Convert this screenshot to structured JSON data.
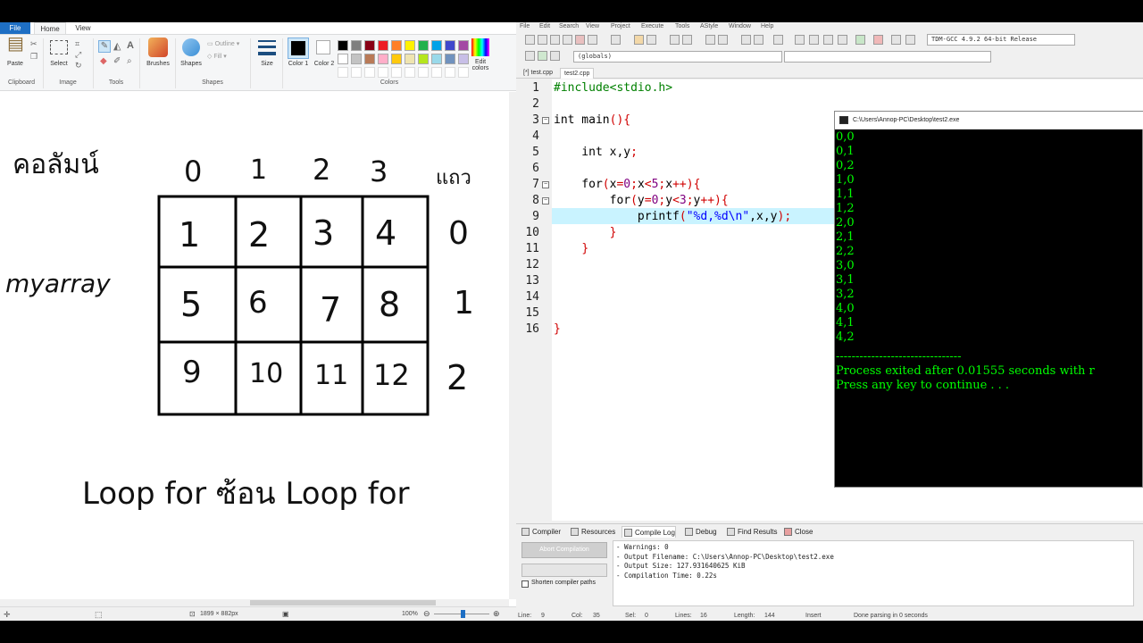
{
  "paint": {
    "tabs": {
      "file": "File",
      "home": "Home",
      "view": "View"
    },
    "ribbon": {
      "paste": "Paste",
      "select": "Select",
      "brushes": "Brushes",
      "shapes": "Shapes",
      "outline": "Outline",
      "fill": "Fill",
      "size": "Size",
      "color1": "Color 1",
      "color2": "Color 2",
      "edit_colors": "Edit colors",
      "groups": {
        "clipboard": "Clipboard",
        "image": "Image",
        "tools": "Tools",
        "shapes": "Shapes",
        "colors": "Colors"
      },
      "palette": [
        "#000000",
        "#7f7f7f",
        "#880015",
        "#ed1c24",
        "#ff7f27",
        "#fff200",
        "#22b14c",
        "#00a2e8",
        "#3f48cc",
        "#a349a4",
        "#ffffff",
        "#c3c3c3",
        "#b97a57",
        "#ffaec9",
        "#ffc90e",
        "#efe4b0",
        "#b5e61d",
        "#99d9ea",
        "#7092be",
        "#c8bfe7"
      ]
    },
    "drawing": {
      "thai_column": "คอลัมน์",
      "thai_row": "แถว",
      "array_name": "myarray",
      "col_headers": [
        "0",
        "1",
        "2",
        "3"
      ],
      "row_headers": [
        "0",
        "1",
        "2"
      ],
      "cells": [
        [
          "1",
          "2",
          "3",
          "4"
        ],
        [
          "5",
          "6",
          "7",
          "8"
        ],
        [
          "9",
          "10",
          "11",
          "12"
        ]
      ],
      "caption": "Loop for ซ้อน Loop for"
    },
    "status": {
      "size": "1899 × 882px",
      "zoom": "100%"
    }
  },
  "ide": {
    "menu": [
      "File",
      "Edit",
      "Search",
      "View",
      "Project",
      "Execute",
      "Tools",
      "AStyle",
      "Window",
      "Help"
    ],
    "compiler_select": "TDM-GCC 4.9.2 64-bit Release",
    "scope_select": "(globals)",
    "file_tabs": [
      "[*] test.cpp",
      "test2.cpp"
    ],
    "code_lines": [
      "#include<stdio.h>",
      "",
      "int main(){",
      "",
      "    int x,y;",
      "",
      "    for(x=0;x<5;x++){",
      "        for(y=0;y<3;y++){",
      "            printf(\"%d,%d\\n\",x,y);",
      "        }",
      "    }",
      "",
      "",
      "",
      "",
      "}"
    ],
    "line_numbers": [
      "1",
      "2",
      "3",
      "4",
      "5",
      "6",
      "7",
      "8",
      "9",
      "10",
      "11",
      "12",
      "13",
      "14",
      "15",
      "16"
    ],
    "bottom_tabs": [
      "Compiler",
      "Resources",
      "Compile Log",
      "Debug",
      "Find Results",
      "Close"
    ],
    "abort_button": "Abort Compilation",
    "shorten_paths": "Shorten compiler paths",
    "log_lines": [
      "- Warnings: 0",
      "- Output Filename: C:\\Users\\Annop-PC\\Desktop\\test2.exe",
      "- Output Size: 127.931640625 KiB",
      "- Compilation Time: 0.22s"
    ],
    "status": {
      "line_label": "Line:",
      "line": "9",
      "col_label": "Col:",
      "col": "35",
      "sel_label": "Sel:",
      "sel": "0",
      "lines_label": "Lines:",
      "lines": "16",
      "length_label": "Length:",
      "length": "144",
      "mode": "Insert",
      "message": "Done parsing in 0 seconds"
    }
  },
  "console": {
    "title": "C:\\Users\\Annop-PC\\Desktop\\test2.exe",
    "output": [
      "0,0",
      "0,1",
      "0,2",
      "1,0",
      "1,1",
      "1,2",
      "2,0",
      "2,1",
      "2,2",
      "3,0",
      "3,1",
      "3,2",
      "4,0",
      "4,1",
      "4,2"
    ],
    "separator": "--------------------------------",
    "exit_message": "Process exited after 0.01555 seconds with r",
    "continue_message": "Press any key to continue . . .",
    "colors": {
      "output": "#00ff00",
      "text": "#c0c0c0"
    }
  }
}
